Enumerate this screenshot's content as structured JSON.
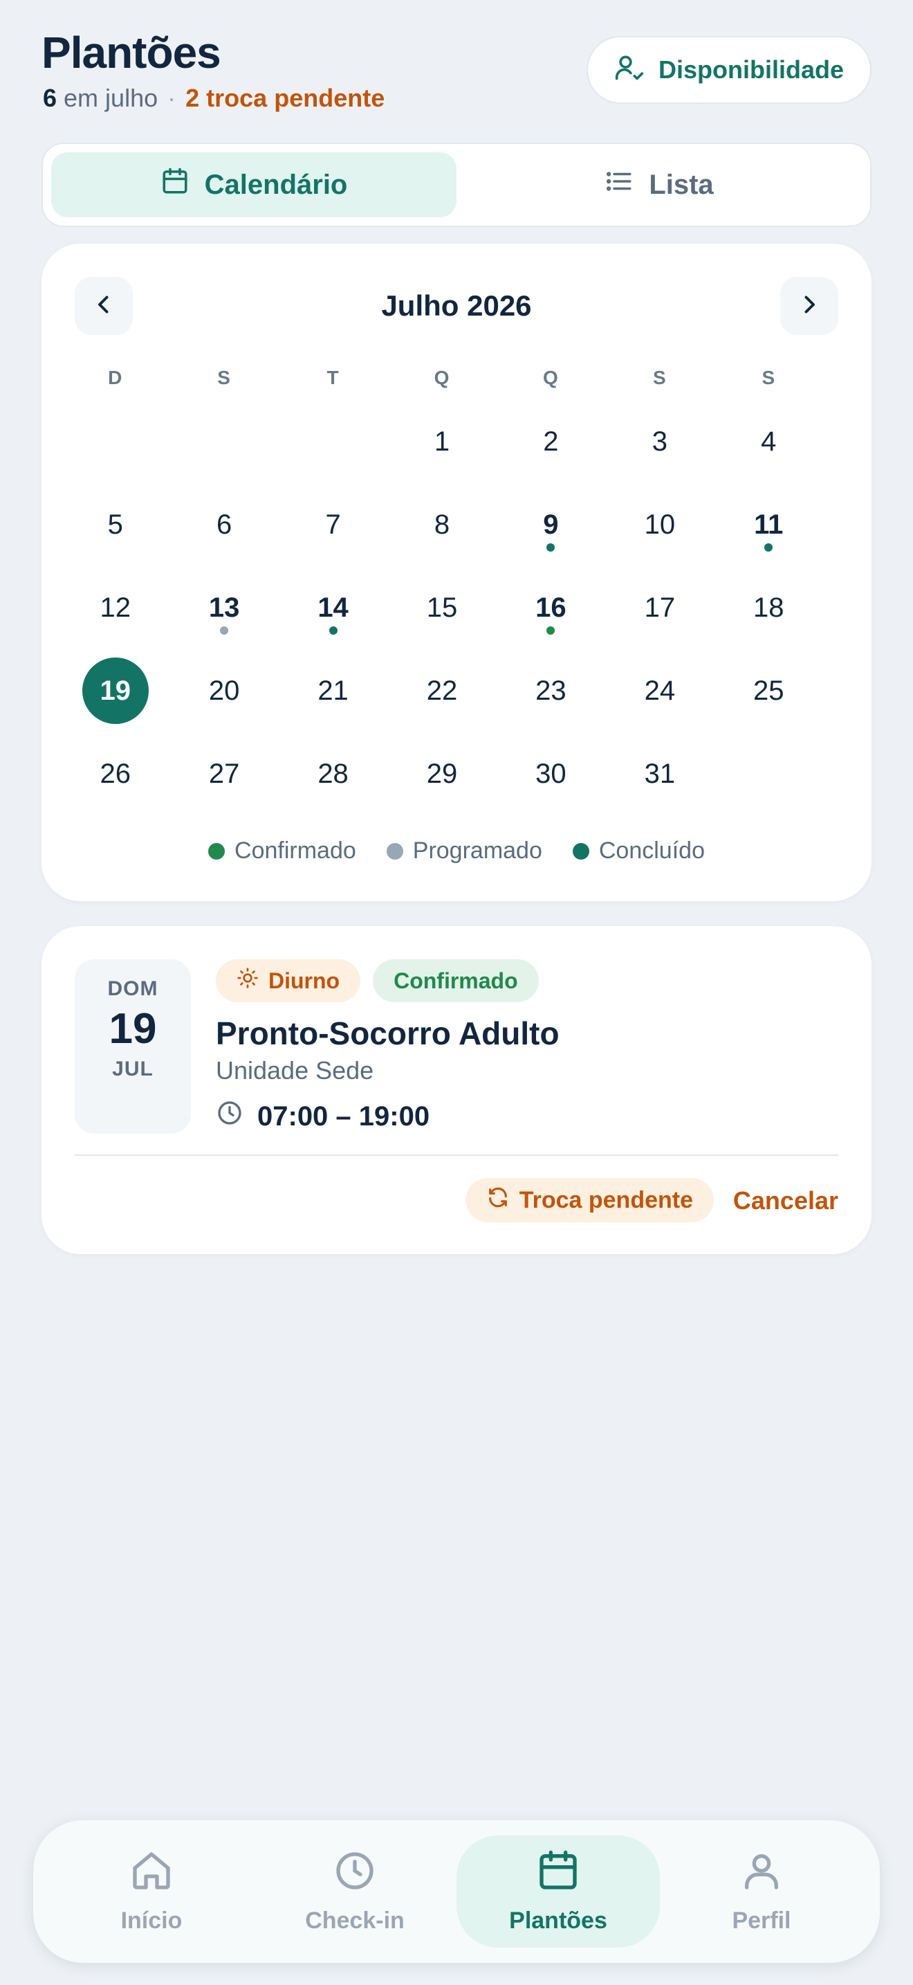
{
  "header": {
    "title": "Plantões",
    "count": "6",
    "count_suffix": " em julho",
    "separator": "·",
    "pending": "2 troca pendente",
    "availability_label": "Disponibilidade"
  },
  "tabs": [
    {
      "label": "Calendário",
      "active": true
    },
    {
      "label": "Lista",
      "active": false
    }
  ],
  "calendar": {
    "month_title": "Julho 2026",
    "weekdays": [
      "D",
      "S",
      "T",
      "Q",
      "Q",
      "S",
      "S"
    ],
    "days": [
      {
        "n": ""
      },
      {
        "n": ""
      },
      {
        "n": ""
      },
      {
        "n": "1"
      },
      {
        "n": "2"
      },
      {
        "n": "3"
      },
      {
        "n": "4"
      },
      {
        "n": "5"
      },
      {
        "n": "6"
      },
      {
        "n": "7"
      },
      {
        "n": "8"
      },
      {
        "n": "9",
        "bold": true,
        "dot": "concluido"
      },
      {
        "n": "10"
      },
      {
        "n": "11",
        "bold": true,
        "dot": "concluido"
      },
      {
        "n": "12"
      },
      {
        "n": "13",
        "bold": true,
        "dot": "programado"
      },
      {
        "n": "14",
        "bold": true,
        "dot": "concluido"
      },
      {
        "n": "15"
      },
      {
        "n": "16",
        "bold": true,
        "dot": "confirmado"
      },
      {
        "n": "17"
      },
      {
        "n": "18"
      },
      {
        "n": "19",
        "today": true
      },
      {
        "n": "20"
      },
      {
        "n": "21"
      },
      {
        "n": "22"
      },
      {
        "n": "23"
      },
      {
        "n": "24"
      },
      {
        "n": "25"
      },
      {
        "n": "26"
      },
      {
        "n": "27"
      },
      {
        "n": "28"
      },
      {
        "n": "29"
      },
      {
        "n": "30"
      },
      {
        "n": "31"
      }
    ],
    "legend": [
      {
        "key": "confirmado",
        "label": "Confirmado",
        "color": "#1F8A4C"
      },
      {
        "key": "programado",
        "label": "Programado",
        "color": "#98A6B5"
      },
      {
        "key": "concluido",
        "label": "Concluído",
        "color": "#137466"
      }
    ]
  },
  "shift": {
    "dow": "DOM",
    "day": "19",
    "month": "JUL",
    "shift_badge": "Diurno",
    "status_badge": "Confirmado",
    "title": "Pronto-Socorro Adulto",
    "unit": "Unidade Sede",
    "time": "07:00 – 19:00",
    "swap_label": "Troca pendente",
    "cancel_label": "Cancelar"
  },
  "bottom_nav": [
    {
      "label": "Início",
      "icon": "home-icon",
      "active": false
    },
    {
      "label": "Check-in",
      "icon": "clock-icon",
      "active": false
    },
    {
      "label": "Plantões",
      "icon": "calendar-icon",
      "active": true
    },
    {
      "label": "Perfil",
      "icon": "user-icon",
      "active": false
    }
  ],
  "colors": {
    "primary": "#137466",
    "accent_orange": "#C2540A",
    "background": "#EDF1F5"
  }
}
